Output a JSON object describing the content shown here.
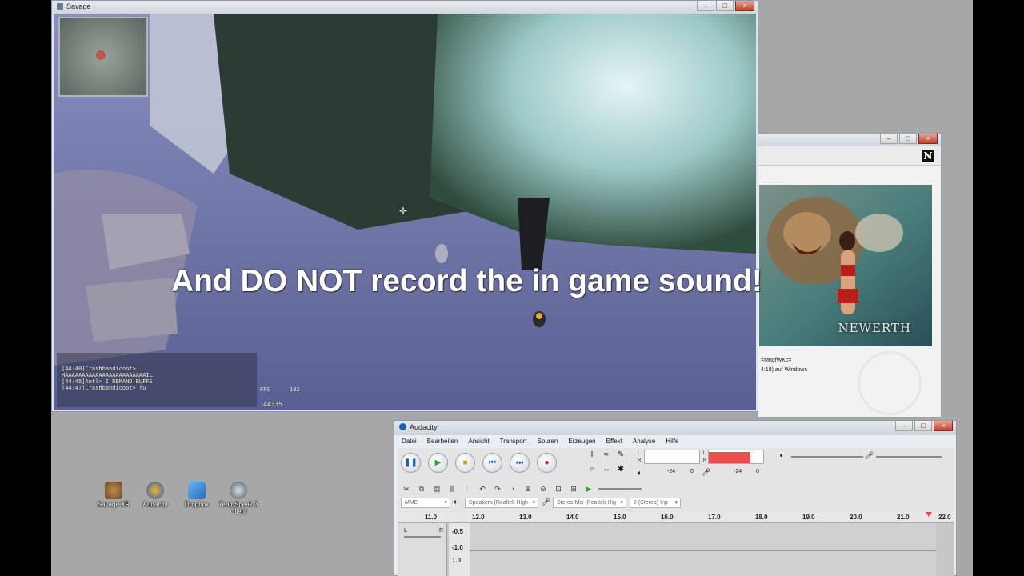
{
  "game_window": {
    "title": "Savage",
    "controls": {
      "minimize": "–",
      "maximize": "□",
      "close": "×"
    },
    "chat_lines": [
      "[44:40]Crashbandicoot>",
      "HAAAAAAAAAAAAAAAAAAAAAAAAIL",
      "[44:45]Antl> I DEMAND BUFFS",
      "[44:47]Crashbandicoot> fu"
    ],
    "fps_label": "FPS",
    "fps_value": "102",
    "clock": "44:35"
  },
  "launcher_window": {
    "controls": {
      "minimize": "–",
      "maximize": "□",
      "close": "×"
    },
    "logo": "N",
    "poster_title": "NEWERTH",
    "text_line_1": "=MngfWKc=",
    "text_line_2": "4:18) auf Windows"
  },
  "audacity_window": {
    "title": "Audacity",
    "controls": {
      "minimize": "–",
      "maximize": "□",
      "close": "×"
    },
    "menu": [
      "Datei",
      "Bearbeiten",
      "Ansicht",
      "Transport",
      "Spuren",
      "Erzeugen",
      "Effekt",
      "Analyse",
      "Hilfe"
    ],
    "meter_channels": [
      "L",
      "R"
    ],
    "meter_db": [
      "-24",
      "0",
      "-24",
      "0"
    ],
    "devices": {
      "host": "MME",
      "output": "Speakers (Realtek High",
      "input": "Stereo Mix (Realtek Hig",
      "channels": "2 (Stereo) Inp"
    },
    "ruler_ticks": [
      "11.0",
      "12.0",
      "13.0",
      "14.0",
      "15.0",
      "16.0",
      "17.0",
      "18.0",
      "19.0",
      "20.0",
      "21.0",
      "22.0"
    ],
    "track_scale": [
      "-0.5",
      "-1.0",
      "1.0"
    ],
    "track_lr": [
      "L",
      "R"
    ]
  },
  "desktop_icons": [
    {
      "label": "Savage XR"
    },
    {
      "label": "Audacity"
    },
    {
      "label": "Dropbox"
    },
    {
      "label": "TeamSpeak 3 Client"
    }
  ],
  "caption": "And DO NOT record the in game sound!",
  "colors": {
    "record_red": "#c4261b",
    "play_green": "#28a52b",
    "pause_blue": "#1b5fb3",
    "meter_red": "#e94f4f",
    "desktop_grey": "#a7a7a7"
  }
}
